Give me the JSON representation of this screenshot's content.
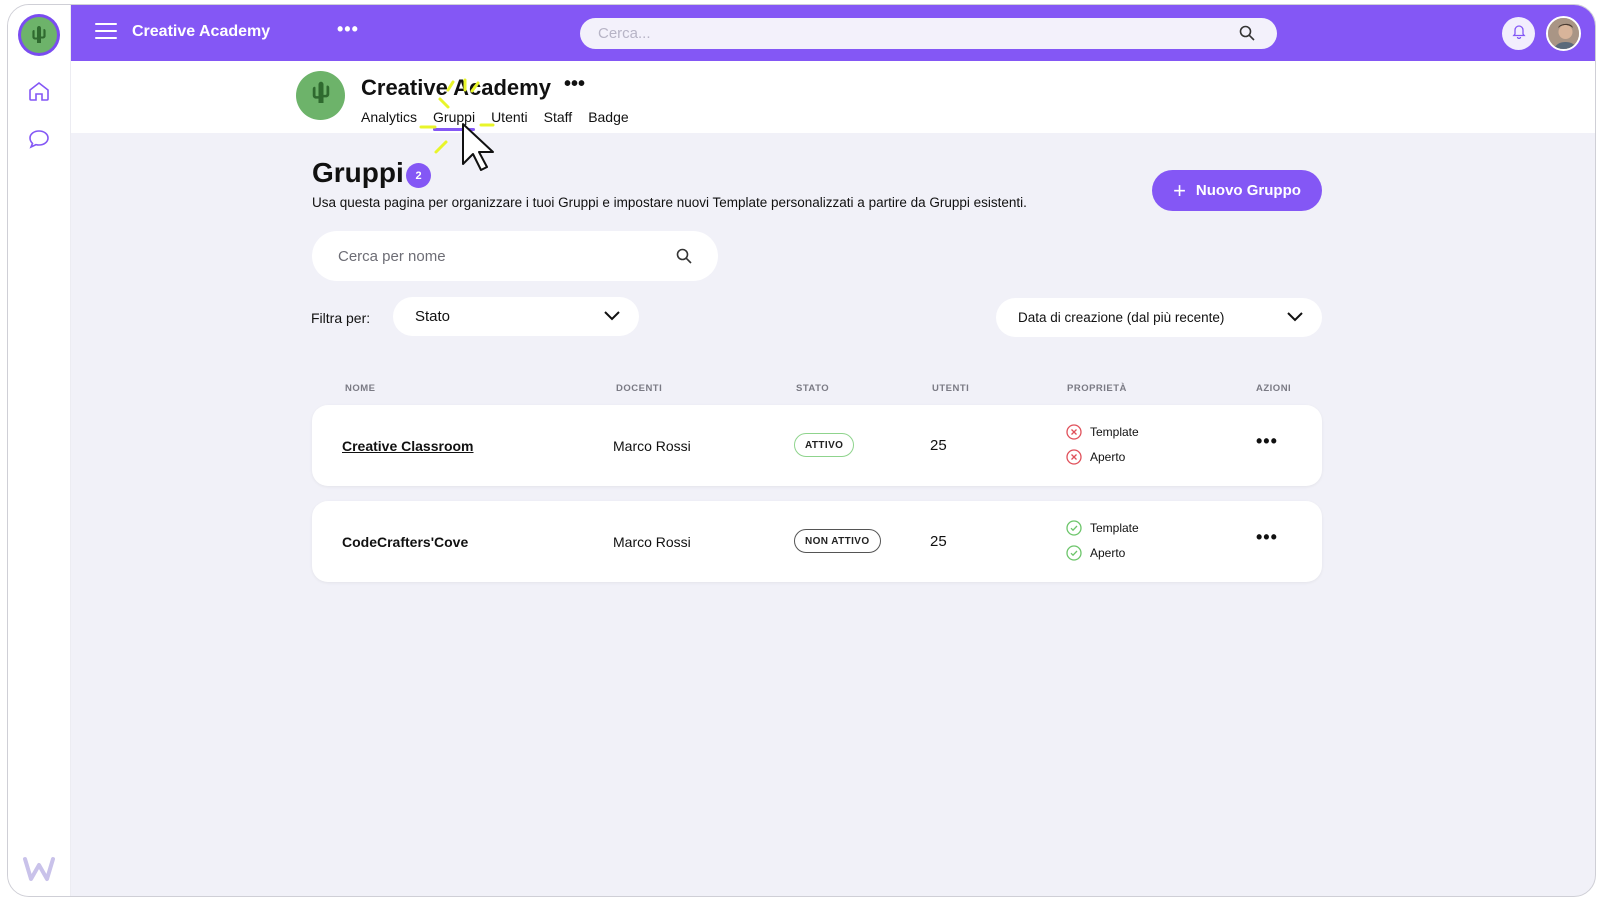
{
  "topbar": {
    "title": "Creative Academy",
    "more_label": "•••",
    "search_placeholder": "Cerca..."
  },
  "header": {
    "org_name": "Creative Academy",
    "more_label": "•••",
    "tabs": [
      {
        "label": "Analytics"
      },
      {
        "label": "Gruppi"
      },
      {
        "label": "Utenti"
      },
      {
        "label": "Staff"
      },
      {
        "label": "Badge"
      }
    ],
    "active_tab": "Gruppi"
  },
  "main": {
    "title": "Gruppi",
    "count": "2",
    "subtitle": "Usa questa pagina per organizzare i tuoi Gruppi e impostare nuovi Template personalizzati a partire da Gruppi esistenti.",
    "new_button_label": "Nuovo Gruppo",
    "search_placeholder": "Cerca per nome",
    "filter_label": "Filtra per:",
    "status_select": "Stato",
    "sort_select": "Data di creazione (dal più recente)"
  },
  "table": {
    "headers": [
      "NOME",
      "DOCENTI",
      "STATO",
      "UTENTI",
      "PROPRIETÀ",
      "AZIONI"
    ],
    "rows": [
      {
        "name": "Creative Classroom",
        "teacher": "Marco Rossi",
        "status": "ATTIVO",
        "users": "25",
        "props": [
          {
            "label": "Template",
            "enabled": false
          },
          {
            "label": "Aperto",
            "enabled": false
          }
        ],
        "actions_label": "•••"
      },
      {
        "name": "CodeCrafters'Cove",
        "teacher": "Marco Rossi",
        "status": "NON ATTIVO",
        "users": "25",
        "props": [
          {
            "label": "Template",
            "enabled": true
          },
          {
            "label": "Aperto",
            "enabled": true
          }
        ],
        "actions_label": "•••"
      }
    ]
  },
  "colors": {
    "brand": "#8457f5",
    "background": "#f1f1f8",
    "active_status": "#8fd48d",
    "error": "#e0505a",
    "success": "#6cc56a"
  },
  "icons": {
    "menu": "hamburger-icon",
    "search": "search-icon",
    "bell": "bell-icon",
    "home": "home-icon",
    "chat": "chat-bubble-icon",
    "cactus": "cactus-logo-icon",
    "close_circle": "x-circle-icon",
    "check_circle": "check-circle-icon",
    "chevron": "chevron-down-icon",
    "plus": "plus-icon"
  }
}
